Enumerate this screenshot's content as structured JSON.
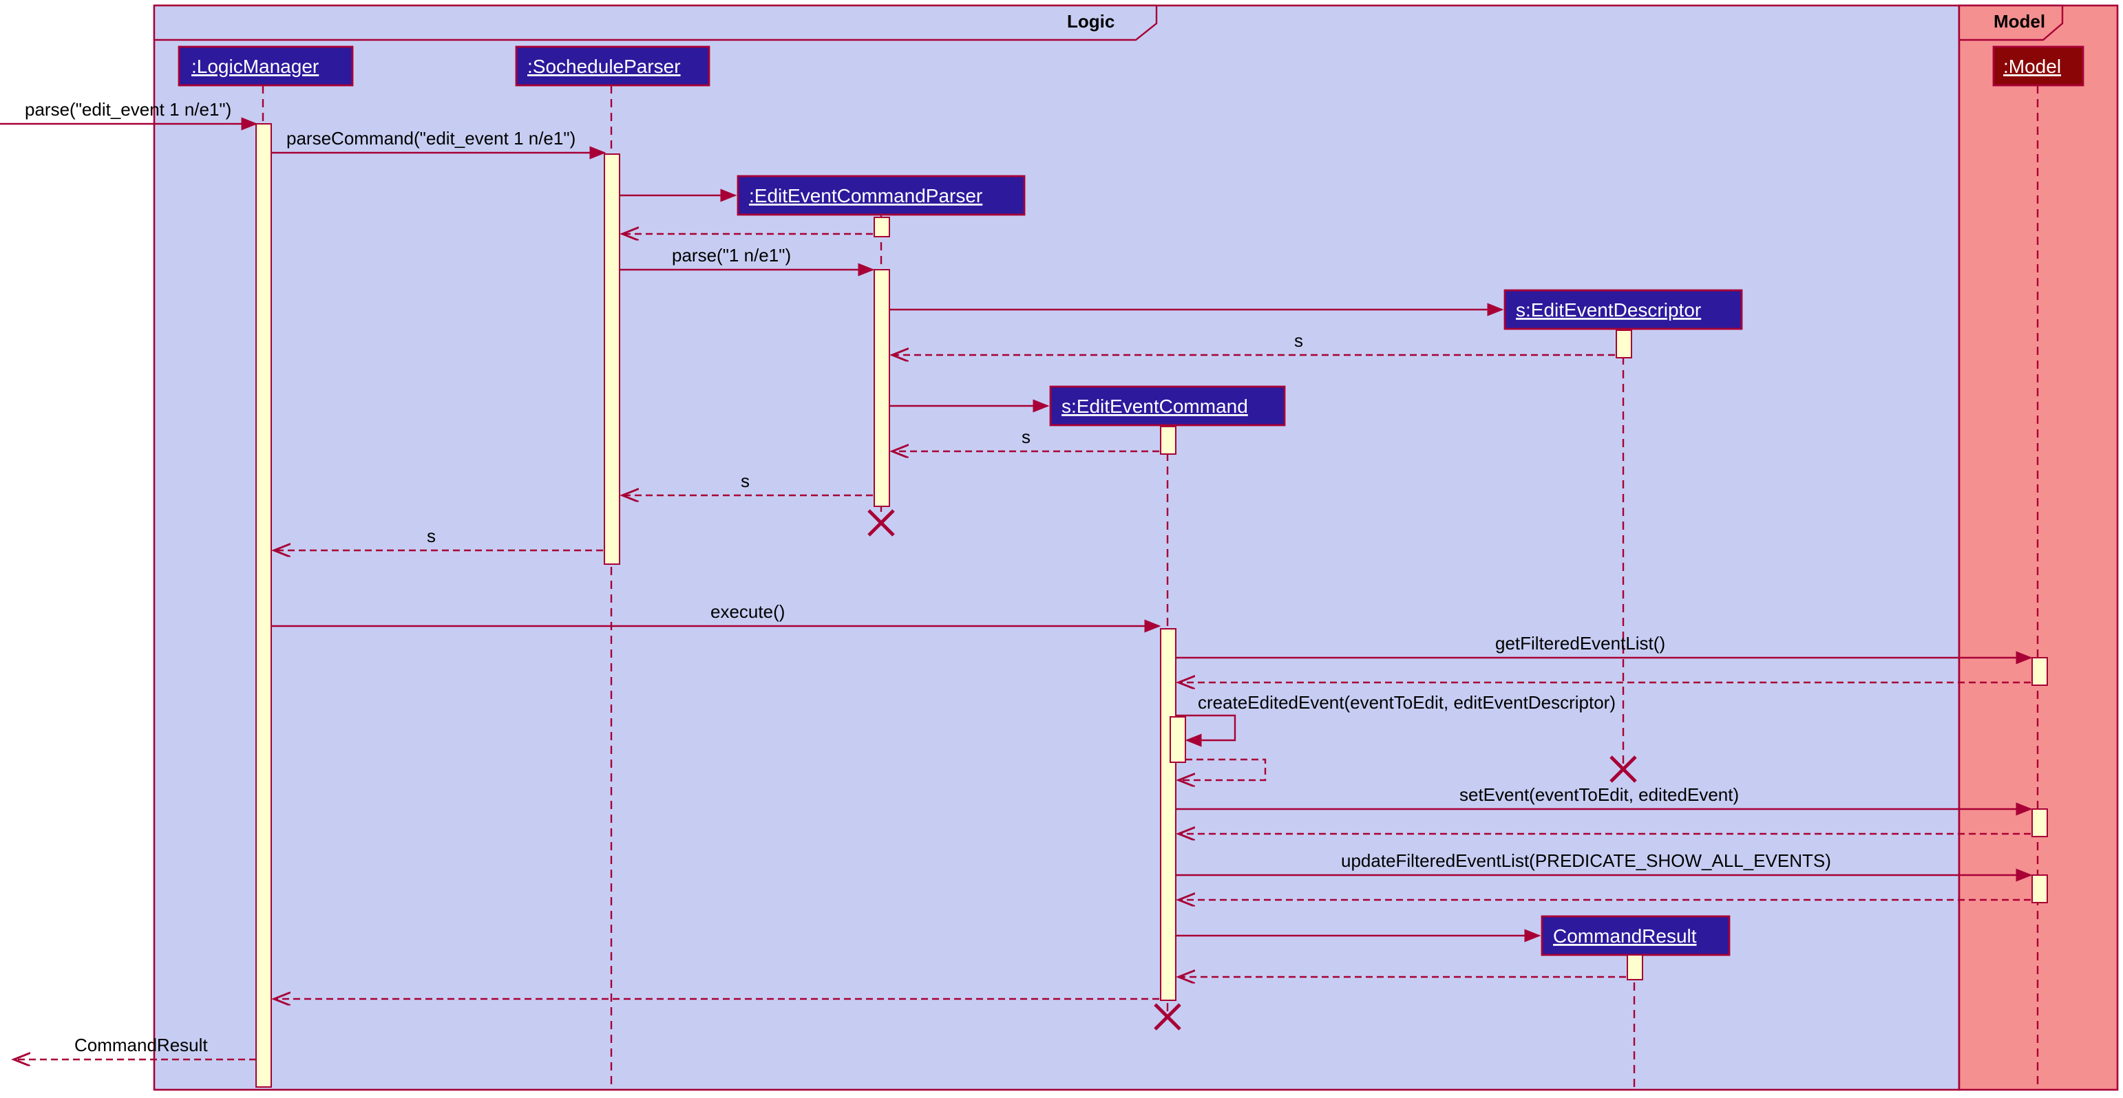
{
  "frames": {
    "logic_title": "Logic",
    "model_title": "Model"
  },
  "participants": {
    "logicManager": ":LogicManager",
    "socheduleParser": ":SocheduleParser",
    "editEventCommandParser": ":EditEventCommandParser",
    "editEventDescriptor": "s:EditEventDescriptor",
    "editEventCommand": "s:EditEventCommand",
    "commandResult": "CommandResult",
    "model": ":Model"
  },
  "messages": {
    "parse_in": "parse(\"edit_event 1 n/e1\")",
    "parseCommand": "parseCommand(\"edit_event 1 n/e1\")",
    "parse_short": "parse(\"1 n/e1\")",
    "return_s1": "s",
    "return_s2": "s",
    "return_s3": "s",
    "return_s4": "s",
    "execute": "execute()",
    "getFilteredEventList": "getFilteredEventList()",
    "createEditedEvent": "createEditedEvent(eventToEdit, editEventDescriptor)",
    "setEvent": "setEvent(eventToEdit, editedEvent)",
    "updateFilteredEventList": "updateFilteredEventList(PREDICATE_SHOW_ALL_EVENTS)",
    "commandResult_out": "CommandResult"
  }
}
